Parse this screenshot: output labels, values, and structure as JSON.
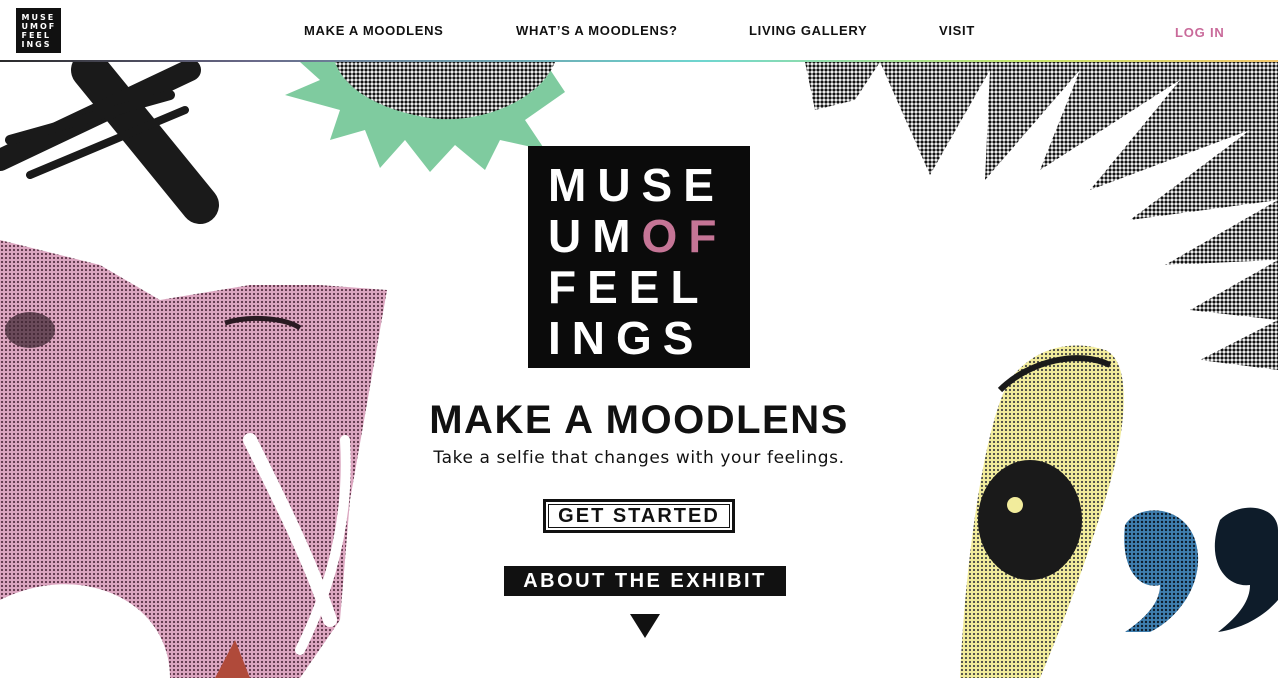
{
  "header": {
    "logo_rows": [
      "MUSE",
      "UMOF",
      "FEEL",
      "INGS"
    ],
    "nav": [
      "MAKE A MOODLENS",
      "WHAT’S A MOODLENS?",
      "LIVING GALLERY",
      "VISIT"
    ],
    "login": "LOG IN"
  },
  "hero": {
    "logo": {
      "row1": "MUSE",
      "row2_a": "UM",
      "row2_b": "OF",
      "row3": "FEEL",
      "row4": "INGS"
    },
    "title": "MAKE A MOODLENS",
    "subtitle": "Take a selfie that changes with your feelings.",
    "cta_label": "GET STARTED",
    "about_label": "ABOUT THE EXHIBIT"
  },
  "colors": {
    "accent_pink": "#c57596",
    "login_pink": "#c96a9a",
    "green": "#7fcb9f",
    "yellow": "#f2ec9c",
    "blue": "#4a8fbf"
  },
  "icons": [
    "down-arrow-icon",
    "quote-mark-icon"
  ]
}
